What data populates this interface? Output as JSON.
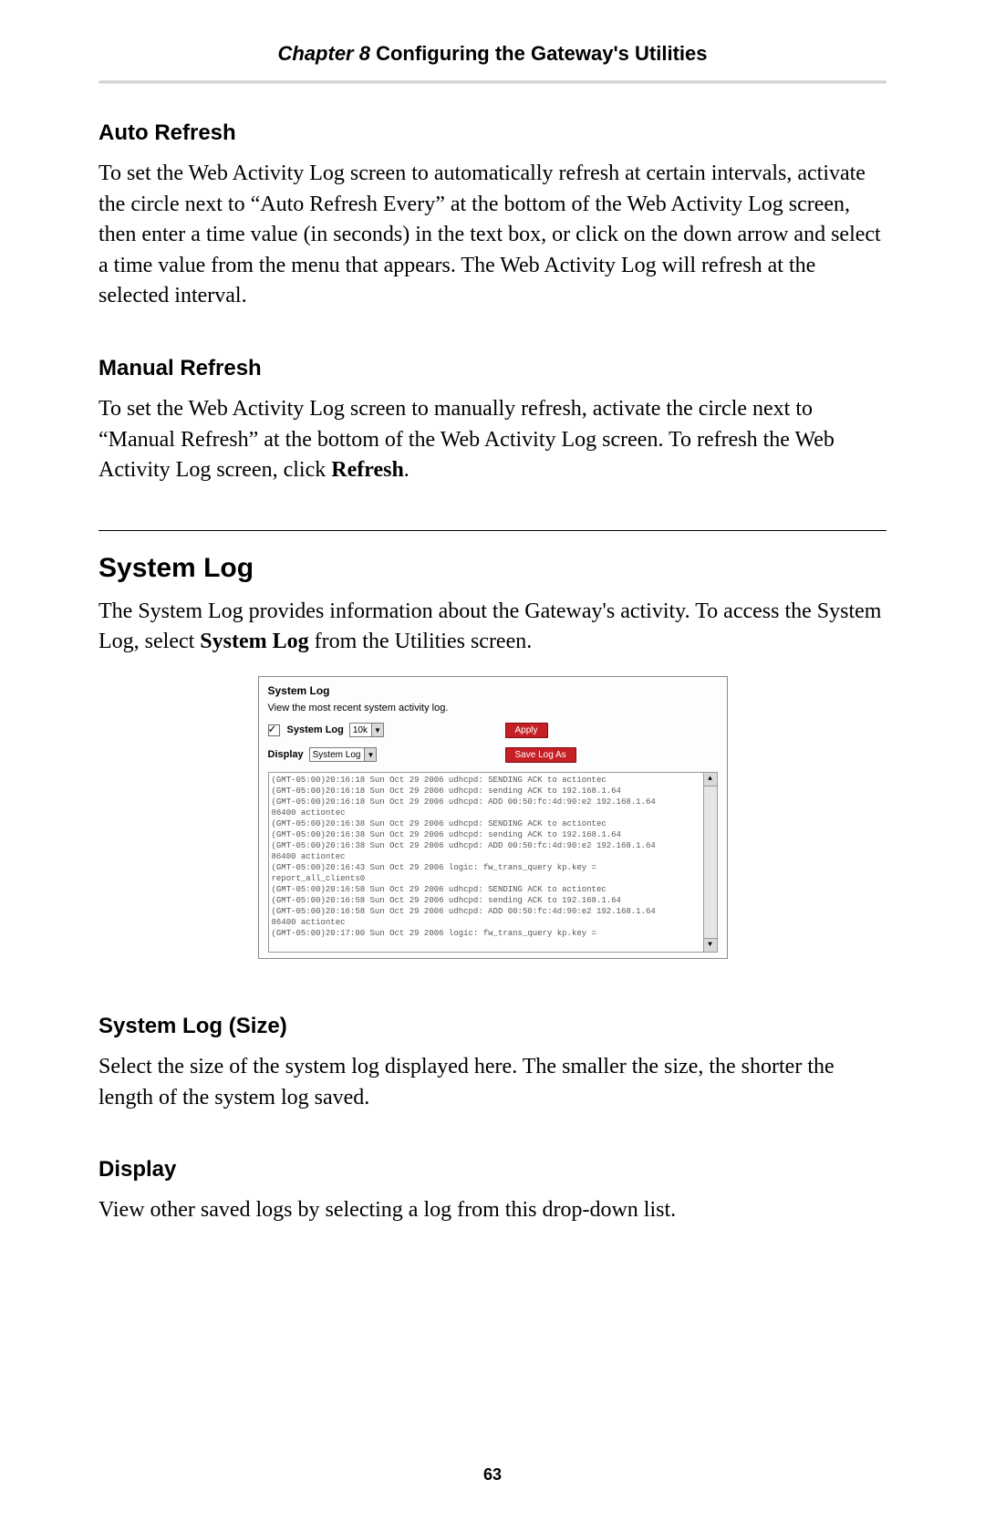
{
  "header": {
    "chapter_label": "Chapter 8",
    "chapter_title": "  Configuring the Gateway's Utilities"
  },
  "sections": {
    "auto_refresh": {
      "heading": "Auto Refresh",
      "body": "To set the Web Activity Log screen to automatically refresh at certain intervals, activate the circle next to “Auto Refresh Every” at the bottom of the Web Activity Log screen, then enter a time value (in seconds) in the text box, or click on the down arrow and select a time value from the menu that appears. The Web Activity Log will refresh at the selected interval."
    },
    "manual_refresh": {
      "heading": "Manual Refresh",
      "body_prefix": "To set the Web Activity Log screen to manually refresh, activate the circle next to “Manual Refresh” at the bottom of the Web Activity Log screen. To refresh the Web Activity Log screen, click ",
      "body_bold": "Refresh",
      "body_suffix": "."
    },
    "system_log": {
      "heading": "System Log",
      "intro_prefix": "The System Log provides information about the Gateway's activity. To access the System Log, select ",
      "intro_bold": "System Log",
      "intro_suffix": " from the Utilities screen."
    },
    "system_log_size": {
      "heading": "System Log (Size)",
      "body": "Select the size of the system log displayed here. The smaller the size, the shorter the length of the system log saved."
    },
    "display": {
      "heading": "Display",
      "body": "View other saved logs by selecting a log from this drop-down list."
    }
  },
  "screenshot": {
    "title": "System Log",
    "subtitle": "View the most recent system activity log.",
    "row1": {
      "checkbox_checked": true,
      "label": "System Log",
      "select_value": "10k",
      "button": "Apply"
    },
    "row2": {
      "label": "Display",
      "select_value": "System Log",
      "button": "Save Log As"
    },
    "log_lines": [
      "(GMT-05:00)20:16:18 Sun Oct 29 2006 udhcpd: SENDING ACK to actiontec",
      "(GMT-05:00)20:16:18 Sun Oct 29 2006 udhcpd: sending ACK to 192.168.1.64",
      "(GMT-05:00)20:16:18 Sun Oct 29 2006 udhcpd: ADD 00:50:fc:4d:90:e2 192.168.1.64",
      "86400 actiontec",
      "(GMT-05:00)20:16:38 Sun Oct 29 2006 udhcpd: SENDING ACK to actiontec",
      "(GMT-05:00)20:16:38 Sun Oct 29 2006 udhcpd: sending ACK to 192.168.1.64",
      "(GMT-05:00)20:16:38 Sun Oct 29 2006 udhcpd: ADD 00:50:fc:4d:90:e2 192.168.1.64",
      "86400 actiontec",
      "(GMT-05:00)20:16:43 Sun Oct 29 2006 logic: fw_trans_query kp.key =",
      "report_all_clients0",
      "(GMT-05:00)20:16:58 Sun Oct 29 2006 udhcpd: SENDING ACK to actiontec",
      "(GMT-05:00)20:16:58 Sun Oct 29 2006 udhcpd: sending ACK to 192.168.1.64",
      "(GMT-05:00)20:16:58 Sun Oct 29 2006 udhcpd: ADD 00:50:fc:4d:90:e2 192.168.1.64",
      "86400 actiontec",
      "(GMT-05:00)20:17:00 Sun Oct 29 2006 logic: fw_trans_query kp.key ="
    ]
  },
  "page_number": "63"
}
